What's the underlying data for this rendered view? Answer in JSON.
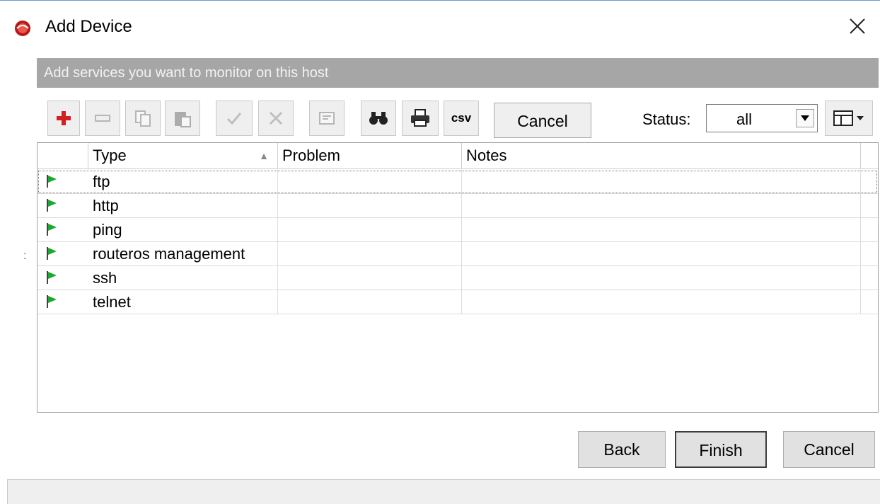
{
  "window": {
    "title": "Add Device",
    "close_icon": "close-icon",
    "app_icon": "app-logo-icon"
  },
  "banner": {
    "text": "Add services you want to monitor on this host"
  },
  "toolbar": {
    "add_icon": "plus-icon",
    "remove_icon": "minus-icon",
    "copy_icon": "copy-icon",
    "paste_icon": "paste-icon",
    "enable_icon": "check-icon",
    "disable_icon": "x-icon",
    "comment_icon": "comment-icon",
    "find_icon": "binoculars-icon",
    "print_icon": "printer-icon",
    "csv_label": "csv",
    "cancel_label": "Cancel",
    "status_label": "Status:",
    "status_value": "all",
    "columns_icon": "column-layout-icon"
  },
  "table": {
    "columns": [
      "Type",
      "Problem",
      "Notes"
    ],
    "sort_column": "Type",
    "rows": [
      {
        "type": "ftp",
        "problem": "",
        "notes": ""
      },
      {
        "type": "http",
        "problem": "",
        "notes": ""
      },
      {
        "type": "ping",
        "problem": "",
        "notes": ""
      },
      {
        "type": "routeros management",
        "problem": "",
        "notes": ""
      },
      {
        "type": "ssh",
        "problem": "",
        "notes": ""
      },
      {
        "type": "telnet",
        "problem": "",
        "notes": ""
      }
    ]
  },
  "footer": {
    "back_label": "Back",
    "finish_label": "Finish",
    "cancel_label": "Cancel"
  },
  "colors": {
    "flag": "#1aa82e",
    "banner": "#a6a6a6",
    "add": "#d21f1f"
  }
}
